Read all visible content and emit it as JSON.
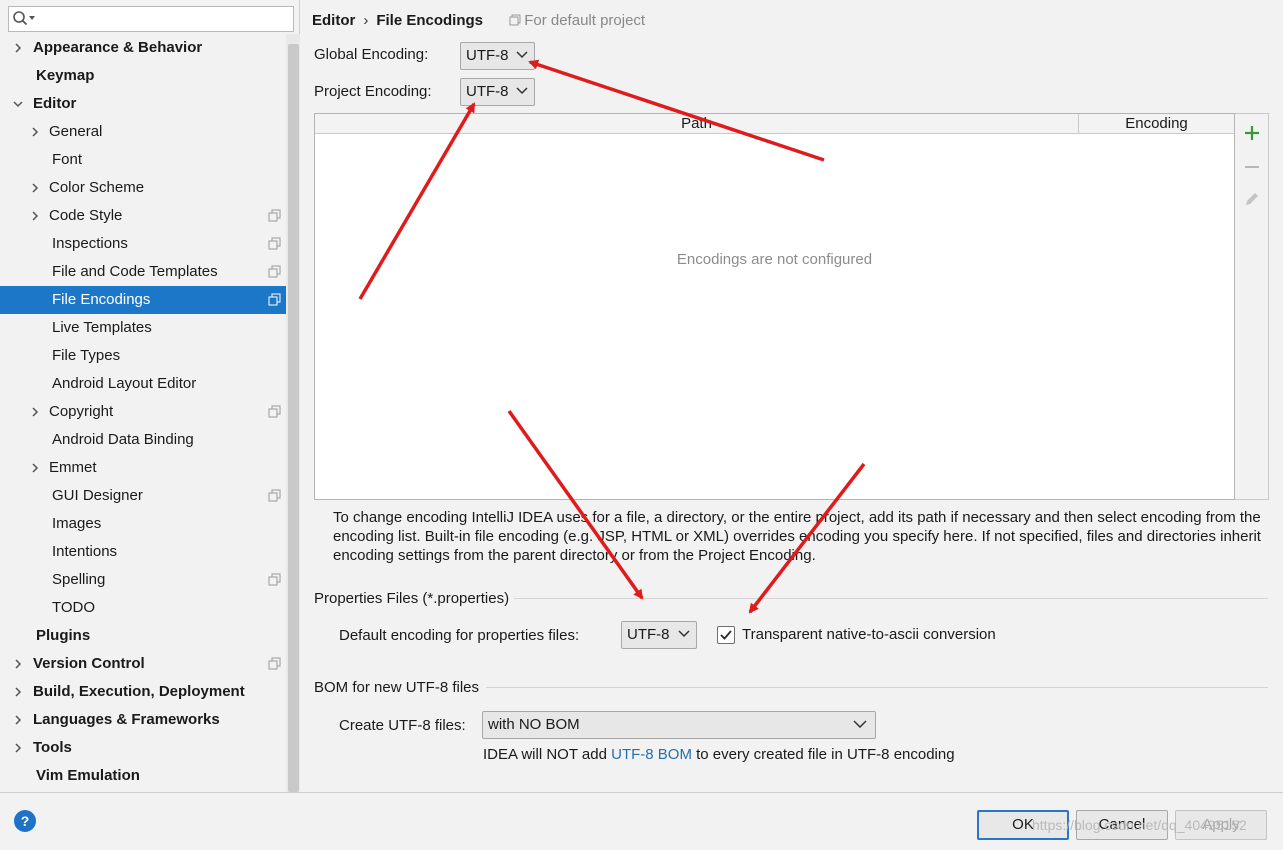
{
  "search": {
    "placeholder": "",
    "value": ""
  },
  "sidebar": {
    "items": [
      {
        "label": "Appearance & Behavior",
        "bold": true,
        "expander": "collapsed",
        "level": 0,
        "name": "sidebar-item-appearance-behavior"
      },
      {
        "label": "Keymap",
        "bold": true,
        "expander": "none",
        "level": 0,
        "name": "sidebar-item-keymap"
      },
      {
        "label": "Editor",
        "bold": true,
        "expander": "expanded",
        "level": 0,
        "name": "sidebar-item-editor"
      },
      {
        "label": "General",
        "expander": "collapsed",
        "level": 1,
        "name": "sidebar-item-general"
      },
      {
        "label": "Font",
        "expander": "none",
        "level": 1,
        "name": "sidebar-item-font"
      },
      {
        "label": "Color Scheme",
        "expander": "collapsed",
        "level": 1,
        "name": "sidebar-item-color-scheme"
      },
      {
        "label": "Code Style",
        "expander": "collapsed",
        "level": 1,
        "copy": true,
        "name": "sidebar-item-code-style"
      },
      {
        "label": "Inspections",
        "expander": "none",
        "level": 1,
        "copy": true,
        "name": "sidebar-item-inspections"
      },
      {
        "label": "File and Code Templates",
        "expander": "none",
        "level": 1,
        "copy": true,
        "name": "sidebar-item-file-and-code-templates"
      },
      {
        "label": "File Encodings",
        "expander": "none",
        "level": 1,
        "copy": true,
        "selected": true,
        "name": "sidebar-item-file-encodings"
      },
      {
        "label": "Live Templates",
        "expander": "none",
        "level": 1,
        "name": "sidebar-item-live-templates"
      },
      {
        "label": "File Types",
        "expander": "none",
        "level": 1,
        "name": "sidebar-item-file-types"
      },
      {
        "label": "Android Layout Editor",
        "expander": "none",
        "level": 1,
        "name": "sidebar-item-android-layout-editor"
      },
      {
        "label": "Copyright",
        "expander": "collapsed",
        "level": 1,
        "copy": true,
        "name": "sidebar-item-copyright"
      },
      {
        "label": "Android Data Binding",
        "expander": "none",
        "level": 1,
        "name": "sidebar-item-android-data-binding"
      },
      {
        "label": "Emmet",
        "expander": "collapsed",
        "level": 1,
        "name": "sidebar-item-emmet"
      },
      {
        "label": "GUI Designer",
        "expander": "none",
        "level": 1,
        "copy": true,
        "name": "sidebar-item-gui-designer"
      },
      {
        "label": "Images",
        "expander": "none",
        "level": 1,
        "name": "sidebar-item-images"
      },
      {
        "label": "Intentions",
        "expander": "none",
        "level": 1,
        "name": "sidebar-item-intentions"
      },
      {
        "label": "Spelling",
        "expander": "none",
        "level": 1,
        "copy": true,
        "name": "sidebar-item-spelling"
      },
      {
        "label": "TODO",
        "expander": "none",
        "level": 1,
        "name": "sidebar-item-todo"
      },
      {
        "label": "Plugins",
        "bold": true,
        "expander": "none",
        "level": 0,
        "name": "sidebar-item-plugins"
      },
      {
        "label": "Version Control",
        "bold": true,
        "expander": "collapsed",
        "level": 0,
        "copy": true,
        "name": "sidebar-item-version-control"
      },
      {
        "label": "Build, Execution, Deployment",
        "bold": true,
        "expander": "collapsed",
        "level": 0,
        "name": "sidebar-item-build-execution-deployment"
      },
      {
        "label": "Languages & Frameworks",
        "bold": true,
        "expander": "collapsed",
        "level": 0,
        "name": "sidebar-item-languages-frameworks"
      },
      {
        "label": "Tools",
        "bold": true,
        "expander": "collapsed",
        "level": 0,
        "name": "sidebar-item-tools"
      },
      {
        "label": "Vim Emulation",
        "bold": true,
        "expander": "none",
        "level": 0,
        "name": "sidebar-item-vim-emulation"
      }
    ]
  },
  "breadcrumb": {
    "parent": "Editor",
    "separator": "›",
    "current": "File Encodings",
    "scope": "For default project"
  },
  "global_encoding": {
    "label": "Global Encoding:",
    "value": "UTF-8"
  },
  "project_encoding": {
    "label": "Project Encoding:",
    "value": "UTF-8"
  },
  "table": {
    "columns": [
      "Path",
      "Encoding"
    ],
    "empty_text": "Encodings are not configured",
    "rows": []
  },
  "toolbar": {
    "add_icon": "plus-icon",
    "remove_icon": "minus-icon",
    "edit_icon": "pencil-icon"
  },
  "help_text": "To change encoding IntelliJ IDEA uses for a file, a directory, or the entire project, add its path if necessary and then select encoding from the encoding list. Built-in file encoding (e.g. JSP, HTML or XML) overrides encoding you specify here. If not specified, files and directories inherit encoding settings from the parent directory or from the Project Encoding.",
  "properties": {
    "group_title": "Properties Files (*.properties)",
    "default_label": "Default encoding for properties files:",
    "default_value": "UTF-8",
    "transparent_label": "Transparent native-to-ascii conversion",
    "transparent_checked": true
  },
  "bom": {
    "group_title": "BOM for new UTF-8 files",
    "create_label": "Create UTF-8 files:",
    "create_value": "with NO BOM",
    "note_prefix": "IDEA will NOT add ",
    "note_link": "UTF-8 BOM",
    "note_suffix": " to every created file in UTF-8 encoding"
  },
  "footer": {
    "help": "?",
    "ok": "OK",
    "cancel": "Cancel",
    "apply": "Apply",
    "apply_enabled": false
  },
  "watermark": "https://blog.csdn.net/qq_40495152",
  "colors": {
    "selection": "#1c77c8",
    "link": "#2470b3",
    "annotation_arrow": "#e01b1b",
    "add_icon": "#3a9a3a"
  }
}
